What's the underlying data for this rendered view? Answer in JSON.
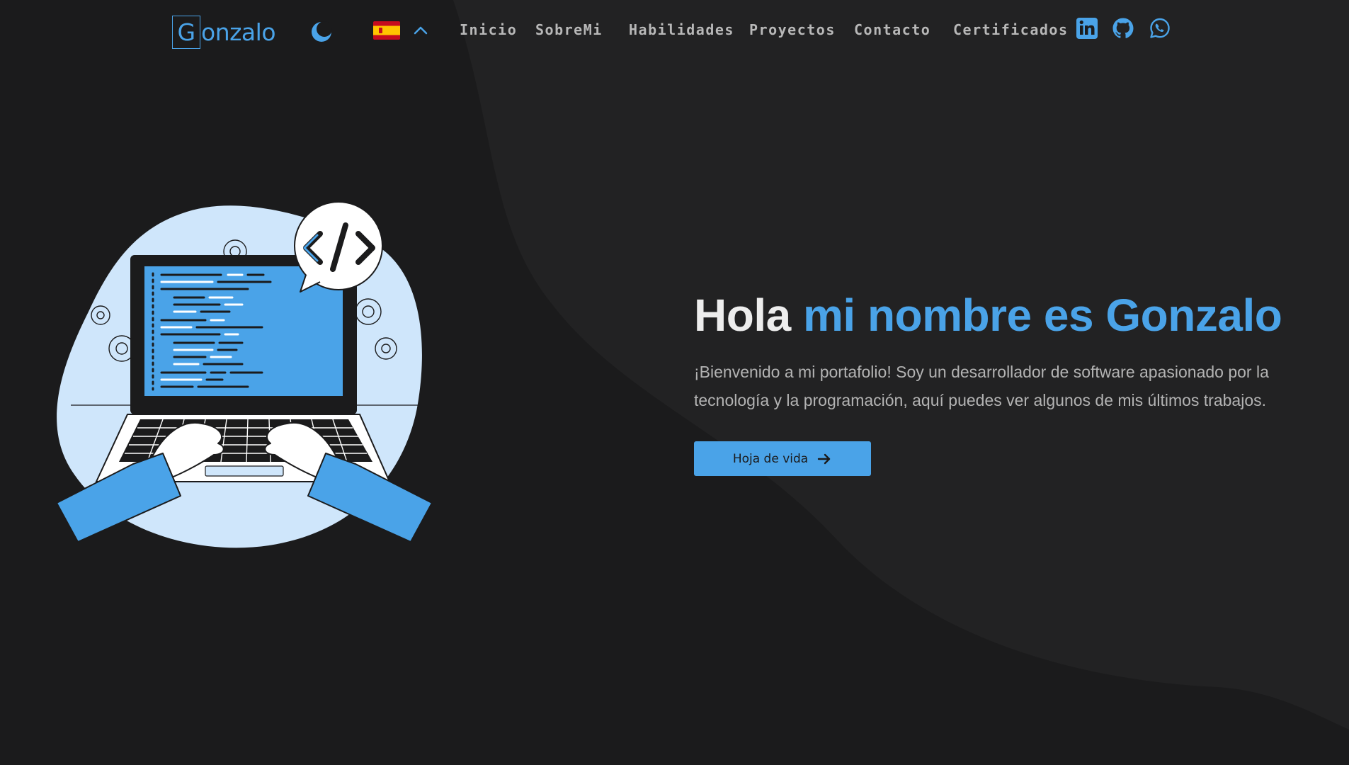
{
  "nav": {
    "logo_initial": "G",
    "logo_rest": "onzalo",
    "links": [
      "Inicio",
      "SobreMi",
      "Habilidades",
      "Proyectos",
      "Contacto",
      "Certificados"
    ],
    "theme_icon": "moon-icon",
    "language_icon": "spain-flag-icon",
    "social_icons": [
      "linkedin-icon",
      "github-icon",
      "whatsapp-icon"
    ]
  },
  "hero": {
    "title_plain": "Hola",
    "title_accent": "mi nombre es Gonzalo",
    "description": "¡Bienvenido a mi portafolio! Soy un desarrollador de software apasionado por la tecnología y la programación, aquí puedes ver algunos de mis últimos trabajos.",
    "cta_label": "Hoja de vida",
    "cta_icon": "arrow-right-icon"
  },
  "colors": {
    "background": "#1b1b1c",
    "accent": "#4aa3e8",
    "nav_text": "#b8b8b8"
  }
}
